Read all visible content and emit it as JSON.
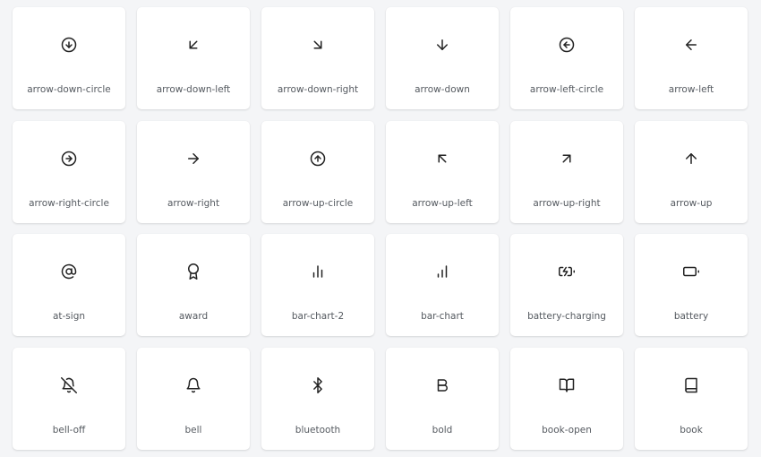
{
  "icons": [
    {
      "name": "arrow-down-circle",
      "icon": "arrow-down-circle-icon"
    },
    {
      "name": "arrow-down-left",
      "icon": "arrow-down-left-icon"
    },
    {
      "name": "arrow-down-right",
      "icon": "arrow-down-right-icon"
    },
    {
      "name": "arrow-down",
      "icon": "arrow-down-icon"
    },
    {
      "name": "arrow-left-circle",
      "icon": "arrow-left-circle-icon"
    },
    {
      "name": "arrow-left",
      "icon": "arrow-left-icon"
    },
    {
      "name": "arrow-right-circle",
      "icon": "arrow-right-circle-icon"
    },
    {
      "name": "arrow-right",
      "icon": "arrow-right-icon"
    },
    {
      "name": "arrow-up-circle",
      "icon": "arrow-up-circle-icon"
    },
    {
      "name": "arrow-up-left",
      "icon": "arrow-up-left-icon"
    },
    {
      "name": "arrow-up-right",
      "icon": "arrow-up-right-icon"
    },
    {
      "name": "arrow-up",
      "icon": "arrow-up-icon"
    },
    {
      "name": "at-sign",
      "icon": "at-sign-icon"
    },
    {
      "name": "award",
      "icon": "award-icon"
    },
    {
      "name": "bar-chart-2",
      "icon": "bar-chart-2-icon"
    },
    {
      "name": "bar-chart",
      "icon": "bar-chart-icon"
    },
    {
      "name": "battery-charging",
      "icon": "battery-charging-icon"
    },
    {
      "name": "battery",
      "icon": "battery-icon"
    },
    {
      "name": "bell-off",
      "icon": "bell-off-icon"
    },
    {
      "name": "bell",
      "icon": "bell-icon"
    },
    {
      "name": "bluetooth",
      "icon": "bluetooth-icon"
    },
    {
      "name": "bold",
      "icon": "bold-icon"
    },
    {
      "name": "book-open",
      "icon": "book-open-icon"
    },
    {
      "name": "book",
      "icon": "book-icon"
    }
  ]
}
